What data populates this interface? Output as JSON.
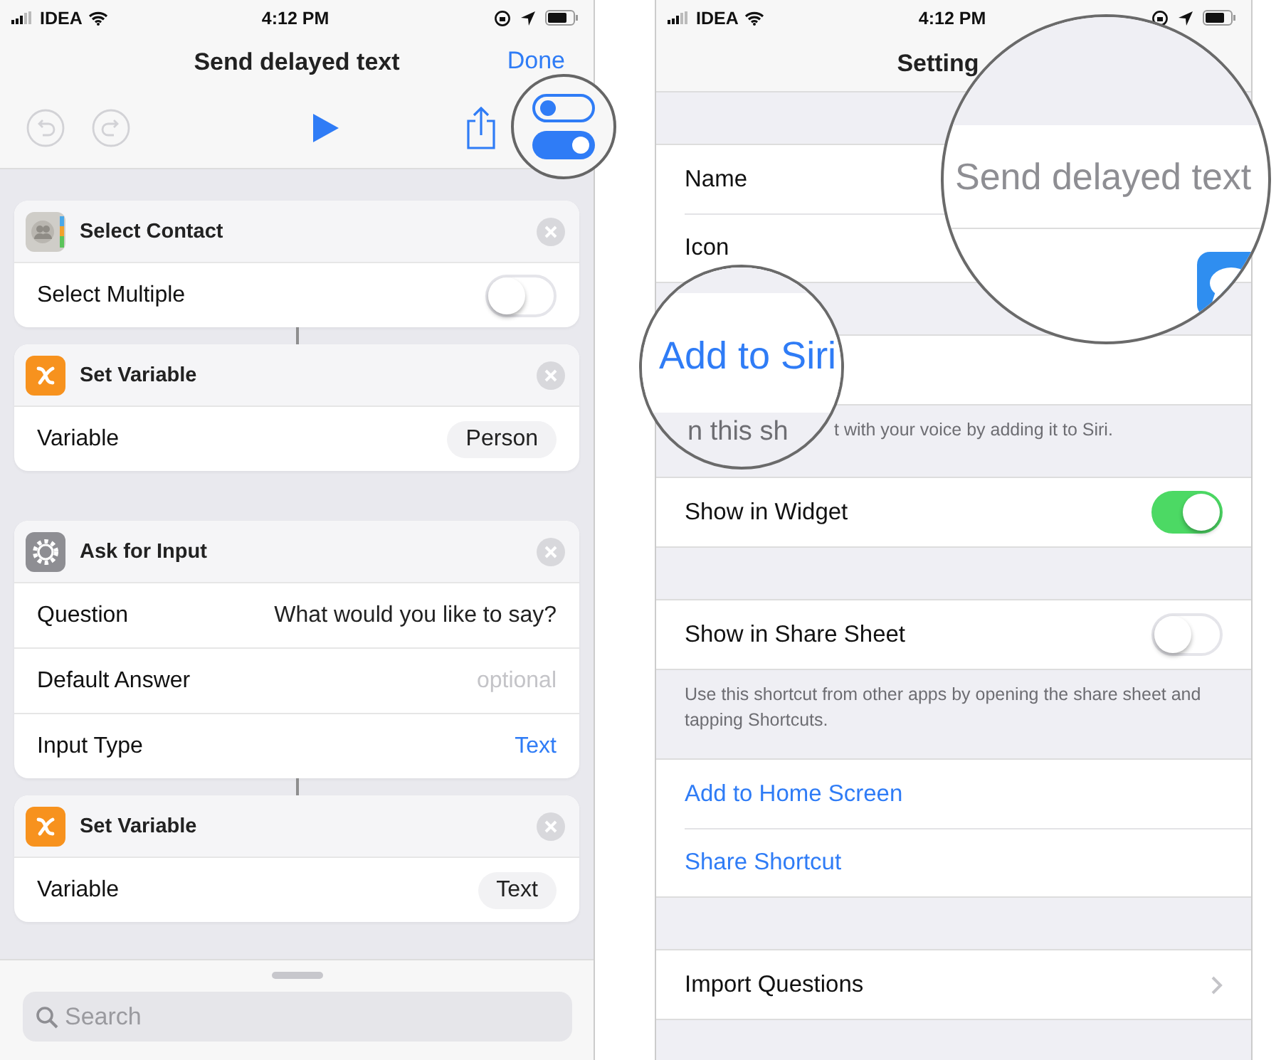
{
  "left_screen": {
    "status_bar": {
      "carrier": "IDEA",
      "time": "4:12 PM"
    },
    "nav": {
      "title": "Send delayed text",
      "done": "Done"
    },
    "toolbar": [
      {
        "kind": "undo",
        "disabled": true
      },
      {
        "kind": "redo",
        "disabled": true
      },
      {
        "kind": "play",
        "disabled": false
      },
      {
        "kind": "share",
        "disabled": false
      }
    ],
    "actions": [
      {
        "kind": "contact",
        "title": "Select Contact",
        "rows": [
          {
            "kind": "switch",
            "label": "Select Multiple",
            "on": false
          }
        ]
      },
      {
        "kind": "variable",
        "title": "Set Variable",
        "linked_to_previous": true,
        "rows": [
          {
            "kind": "token",
            "label": "Variable",
            "value": "Person"
          }
        ]
      },
      {
        "kind": "input",
        "title": "Ask for Input",
        "linked_to_previous": false,
        "rows": [
          {
            "kind": "text",
            "label": "Question",
            "value": "What would you like to say?"
          },
          {
            "kind": "placeholder",
            "label": "Default Answer",
            "placeholder": "optional"
          },
          {
            "kind": "link",
            "label": "Input Type",
            "value": "Text"
          }
        ]
      },
      {
        "kind": "variable",
        "title": "Set Variable",
        "linked_to_previous": true,
        "rows": [
          {
            "kind": "token",
            "label": "Variable",
            "value": "Text"
          }
        ]
      }
    ],
    "search": {
      "placeholder": "Search"
    }
  },
  "right_screen": {
    "status_bar": {
      "carrier": "IDEA",
      "time": "4:12 PM"
    },
    "nav": {
      "title": "Setting"
    },
    "groups": [
      {
        "rows": [
          {
            "kind": "plain",
            "label": "Name"
          },
          {
            "kind": "plain",
            "label": "Icon"
          }
        ]
      },
      {
        "rows": [
          {
            "kind": "empty"
          }
        ],
        "footer": "t with your voice by adding it to Siri."
      },
      {
        "rows": [
          {
            "kind": "switch",
            "label": "Show in Widget",
            "on": true
          }
        ]
      },
      {
        "rows": [
          {
            "kind": "switch",
            "label": "Show in Share Sheet",
            "on": false
          }
        ],
        "footer": "Use this shortcut from other apps by opening the share sheet and tapping Shortcuts."
      },
      {
        "rows": [
          {
            "kind": "link",
            "label": "Add to Home Screen"
          },
          {
            "kind": "link",
            "label": "Share Shortcut"
          }
        ]
      },
      {
        "rows": [
          {
            "kind": "disclosure",
            "label": "Import Questions"
          }
        ]
      }
    ],
    "magnifiers": [
      {
        "kind": "name",
        "value": "Send delayed text"
      },
      {
        "kind": "siri",
        "action": "Add to Siri",
        "fragment": "n this sh"
      }
    ]
  }
}
